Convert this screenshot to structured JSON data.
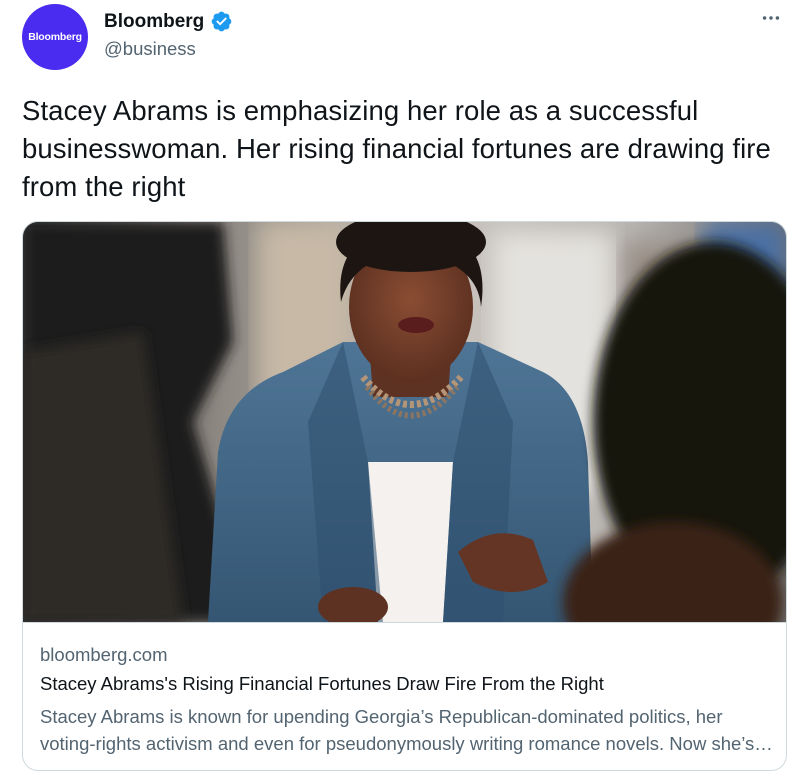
{
  "author": {
    "display_name": "Bloomberg",
    "handle": "@business",
    "avatar_text": "Bloomberg",
    "avatar_color": "#4a2bf0",
    "verified": true,
    "verified_icon": "verified-badge-icon"
  },
  "menu": {
    "icon": "more-horizontal-icon"
  },
  "tweet": {
    "text": "Stacey Abrams is emphasizing her role as a successful businesswoman. Her rising financial fortunes are drawing fire from the right"
  },
  "card": {
    "domain": "bloomberg.com",
    "title": "Stacey Abrams's Rising Financial Fortunes Draw Fire From the Right",
    "description": "Stacey Abrams is known for upending Georgia’s Republican-dominated politics, her voting-rights activism and even for pseudonymously writing romance novels. Now she’s emphasizing another role."
  },
  "colors": {
    "text_primary": "#0f1419",
    "text_secondary": "#536471",
    "verified_blue": "#1d9bf0",
    "border": "#cfd9de"
  }
}
